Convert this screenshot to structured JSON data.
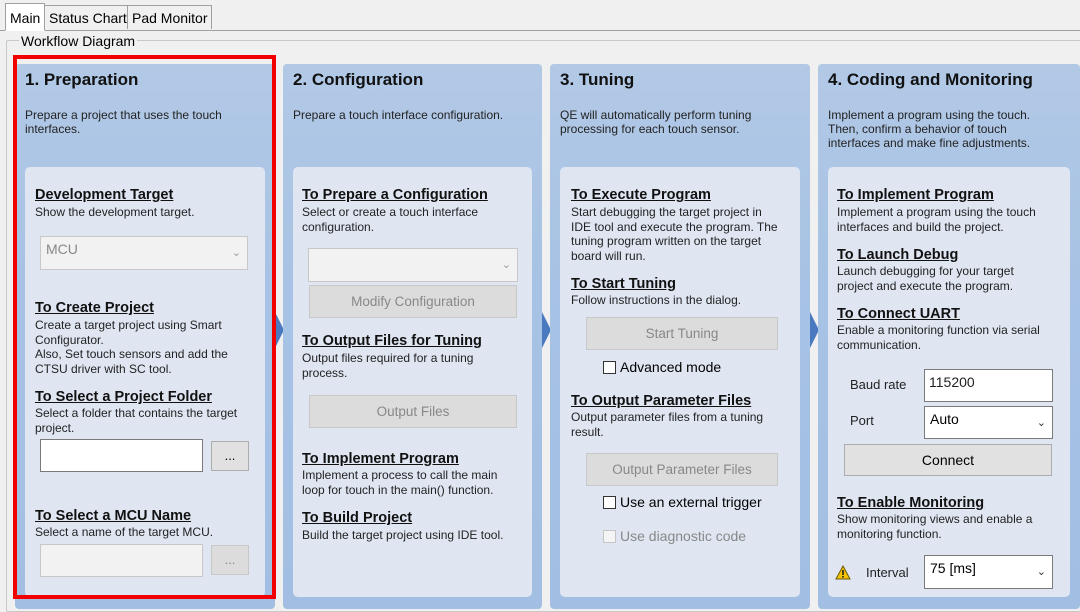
{
  "tabs": [
    "Main",
    "Status Chart",
    "Pad Monitor"
  ],
  "group_label": "Workflow Diagram",
  "stage1": {
    "title": "1. Preparation",
    "desc": [
      "Prepare a project that uses the touch",
      "interfaces."
    ],
    "dev_target": {
      "title": "Development Target",
      "desc": "Show the development target.",
      "combo": "MCU"
    },
    "create_project": {
      "title": "To Create Project",
      "desc": [
        "Create a target project using Smart",
        "Configurator.",
        "Also, Set touch sensors and add the",
        "CTSU driver with SC tool."
      ]
    },
    "select_folder": {
      "title": "To Select a Project Folder",
      "desc": [
        "Select a folder that contains the target",
        "project."
      ],
      "browse": "..."
    },
    "select_mcu": {
      "title": "To Select a MCU Name",
      "desc": "Select a name of the target MCU.",
      "browse": "..."
    }
  },
  "stage2": {
    "title": "2. Configuration",
    "desc": [
      "Prepare a touch interface configuration."
    ],
    "prepare": {
      "title": "To Prepare a Configuration",
      "desc": [
        "Select or create a touch interface",
        "configuration."
      ],
      "button": "Modify Configuration"
    },
    "output": {
      "title": "To Output Files for Tuning",
      "desc": [
        "Output files required for a tuning",
        "process."
      ],
      "button": "Output Files"
    },
    "implement": {
      "title": "To Implement Program",
      "desc": [
        "Implement a process to call the main",
        "loop for touch in the main() function."
      ]
    },
    "build": {
      "title": "To Build Project",
      "desc": "Build the target project using IDE tool."
    }
  },
  "stage3": {
    "title": "3. Tuning",
    "desc": [
      "QE will automatically perform tuning",
      "processing for each touch sensor."
    ],
    "execute": {
      "title": "To Execute Program",
      "desc": [
        "Start debugging the target project in",
        "IDE tool and execute the program. The",
        "tuning program written on the target",
        "board will run."
      ]
    },
    "start": {
      "title": "To Start Tuning",
      "desc": "Follow instructions in the dialog.",
      "button": "Start Tuning",
      "checkbox": "Advanced mode"
    },
    "output_params": {
      "title": "To Output Parameter Files",
      "desc": [
        "Output parameter files from a tuning",
        "result."
      ],
      "button": "Output Parameter Files",
      "checkbox1": "Use an external trigger",
      "checkbox2": "Use diagnostic code"
    }
  },
  "stage4": {
    "title": "4. Coding and Monitoring",
    "desc": [
      "Implement a program using the touch.",
      "Then, confirm a behavior of touch",
      "interfaces and make fine adjustments."
    ],
    "implement": {
      "title": "To Implement Program",
      "desc": [
        "Implement a program using the touch",
        "interfaces and build the project."
      ]
    },
    "debug": {
      "title": "To Launch Debug",
      "desc": [
        "Launch debugging for your target",
        "project and execute the program."
      ]
    },
    "uart": {
      "title": "To Connect UART",
      "desc": [
        "Enable a monitoring function via serial",
        "communication."
      ],
      "baud_label": "Baud rate",
      "baud_value": "115200",
      "port_label": "Port",
      "port_value": "Auto",
      "button": "Connect"
    },
    "monitoring": {
      "title": "To Enable Monitoring",
      "desc": [
        "Show monitoring views and enable a",
        "monitoring function."
      ],
      "interval_label": "Interval",
      "interval_value": "75 [ms]"
    }
  },
  "colors": {
    "highlight": "#f20000",
    "arrow": "#4a79c0",
    "panel": "#a7c2e4"
  },
  "icons": [
    "warning-icon",
    "chevron-down-icon"
  ]
}
